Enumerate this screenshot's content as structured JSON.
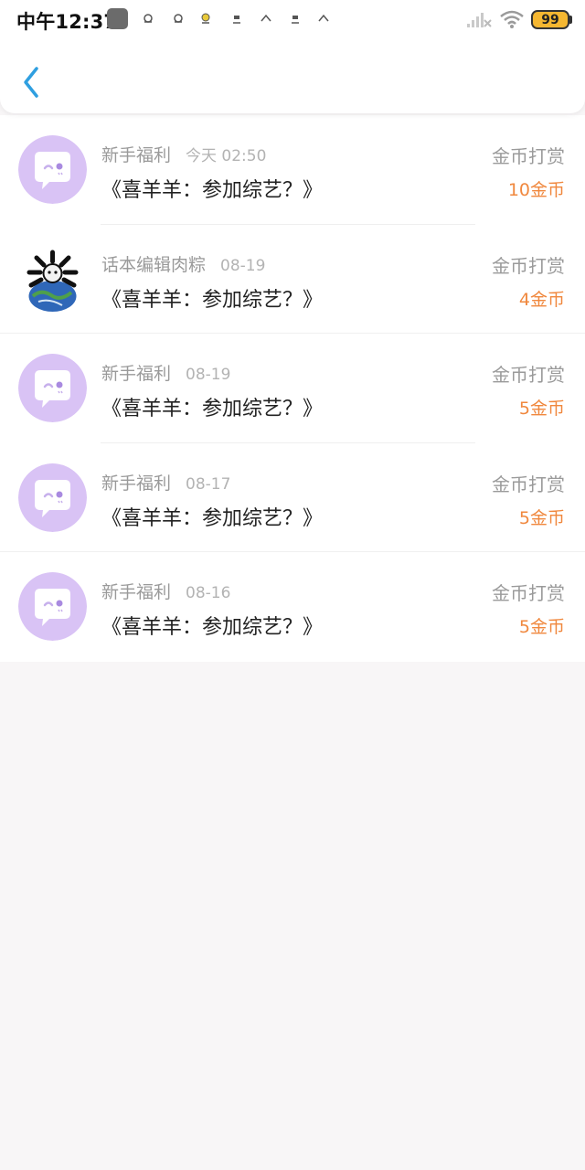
{
  "status_bar": {
    "time": "中午12:37",
    "battery": "99",
    "colors": {
      "battery_fill": "#f5b731"
    }
  },
  "header": {
    "back_icon": "chevron-left-icon",
    "accent_color": "#2f9fe0"
  },
  "records": [
    {
      "sender": "新手福利",
      "date": "今天 02:50",
      "title": "《喜羊羊：参加综艺？》",
      "type": "金币打赏",
      "amount": "10金币",
      "avatar": "chat-bubble-icon"
    },
    {
      "sender": "话本编辑肉粽",
      "date": "08-19",
      "title": "《喜羊羊：参加综艺？》",
      "type": "金币打赏",
      "amount": "4金币",
      "avatar": "user-photo-avatar"
    },
    {
      "sender": "新手福利",
      "date": "08-19",
      "title": "《喜羊羊：参加综艺？》",
      "type": "金币打赏",
      "amount": "5金币",
      "avatar": "chat-bubble-icon"
    },
    {
      "sender": "新手福利",
      "date": "08-17",
      "title": "《喜羊羊：参加综艺？》",
      "type": "金币打赏",
      "amount": "5金币",
      "avatar": "chat-bubble-icon"
    },
    {
      "sender": "新手福利",
      "date": "08-16",
      "title": "《喜羊羊：参加综艺？》",
      "type": "金币打赏",
      "amount": "5金币",
      "avatar": "chat-bubble-icon"
    }
  ],
  "colors": {
    "amount": "#f0883e",
    "avatar_bg": "#d9c3f5",
    "background": "#f8f6f7"
  }
}
